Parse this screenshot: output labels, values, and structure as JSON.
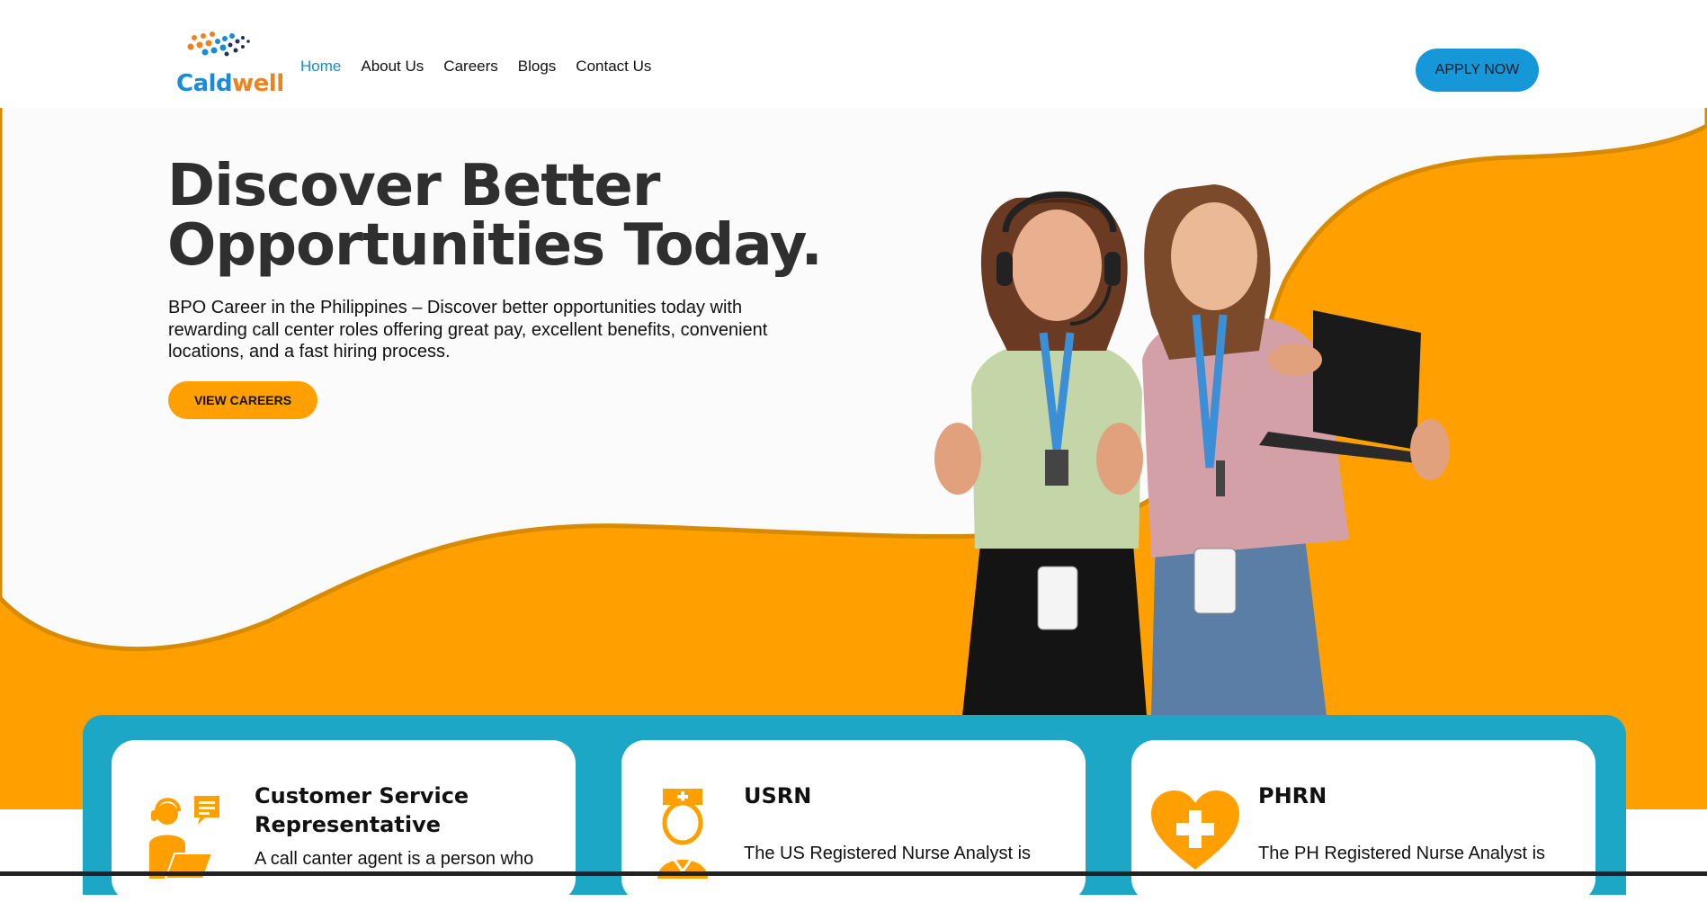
{
  "brand": {
    "logo_part1": "Cald",
    "logo_part2": "well",
    "accent": "#ffa000",
    "primary": "#1597d8",
    "teal": "#1da7c7"
  },
  "nav": {
    "items": [
      "Home",
      "About Us",
      "Careers",
      "Blogs",
      "Contact Us"
    ],
    "active": "Home"
  },
  "header": {
    "apply_label": "APPLY NOW"
  },
  "hero": {
    "title_line1": "Discover Better",
    "title_line2": "Opportunities Today.",
    "description": "BPO Career in the Philippines – Discover better opportunities today with rewarding call center roles offering great pay, excellent benefits, convenient locations, and a fast hiring process.",
    "cta_label": "VIEW CAREERS"
  },
  "cards": [
    {
      "title": "Customer Service Representative",
      "desc": "A call canter agent is a person who",
      "icon": "agent-headset-icon"
    },
    {
      "title": "USRN",
      "desc": "The US Registered Nurse Analyst is",
      "icon": "nurse-icon"
    },
    {
      "title": "PHRN",
      "desc": "The PH Registered Nurse Analyst is",
      "icon": "heart-plus-icon"
    }
  ]
}
